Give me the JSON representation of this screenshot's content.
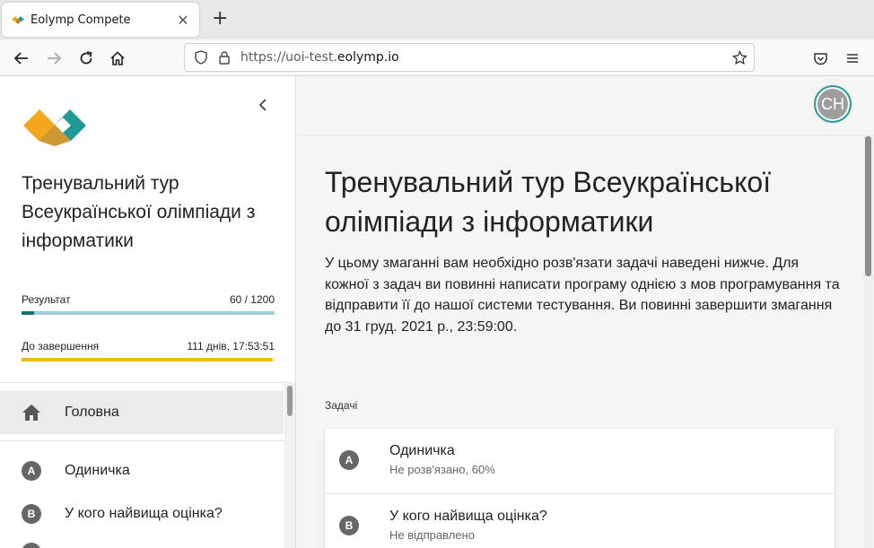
{
  "browser": {
    "tab_title": "Eolymp Compete",
    "tab_close": "✕",
    "new_tab": "+",
    "url_prefix": "https://uoi-test.",
    "url_domain": "eolymp.io"
  },
  "sidebar": {
    "contest_title": "Тренувальний тур Всеукраїнської олімпіади з інформатики",
    "result_label": "Результат",
    "result_value": "60 / 1200",
    "result_progress": 0.05,
    "time_label": "До завершення",
    "time_value": "111 днів, 17:53:51",
    "time_progress": 0.99,
    "menu": [
      {
        "label": "Головна",
        "icon": "home-icon"
      },
      {
        "badge": "A",
        "label": "Одиничка"
      },
      {
        "badge": "B",
        "label": "У кого найвища оцінка?"
      }
    ]
  },
  "user": {
    "initials": "CH"
  },
  "main": {
    "title": "Тренувальний тур Всеукраїнської олімпіади з інформатики",
    "description": "У цьому змаганні вам необхідно розв'язати задачі наведені нижче. Для кожної з задач ви повинні написати програму однією з мов програмування та відправити її до нашої системи тестування. Ви повинні завершити змагання до 31 груд. 2021 р., 23:59:00.",
    "problems_label": "Задачі",
    "problems": [
      {
        "badge": "A",
        "name": "Одиничка",
        "status": "Не розв'язано, 60%"
      },
      {
        "badge": "B",
        "name": "У кого найвища оцінка?",
        "status": "Не відправлено"
      }
    ]
  },
  "colors": {
    "accent_teal": "#2a9c9c",
    "progress_track": "#9fcfd0",
    "progress_fill": "#1d6f70",
    "time_bar": "#f1b90f"
  }
}
